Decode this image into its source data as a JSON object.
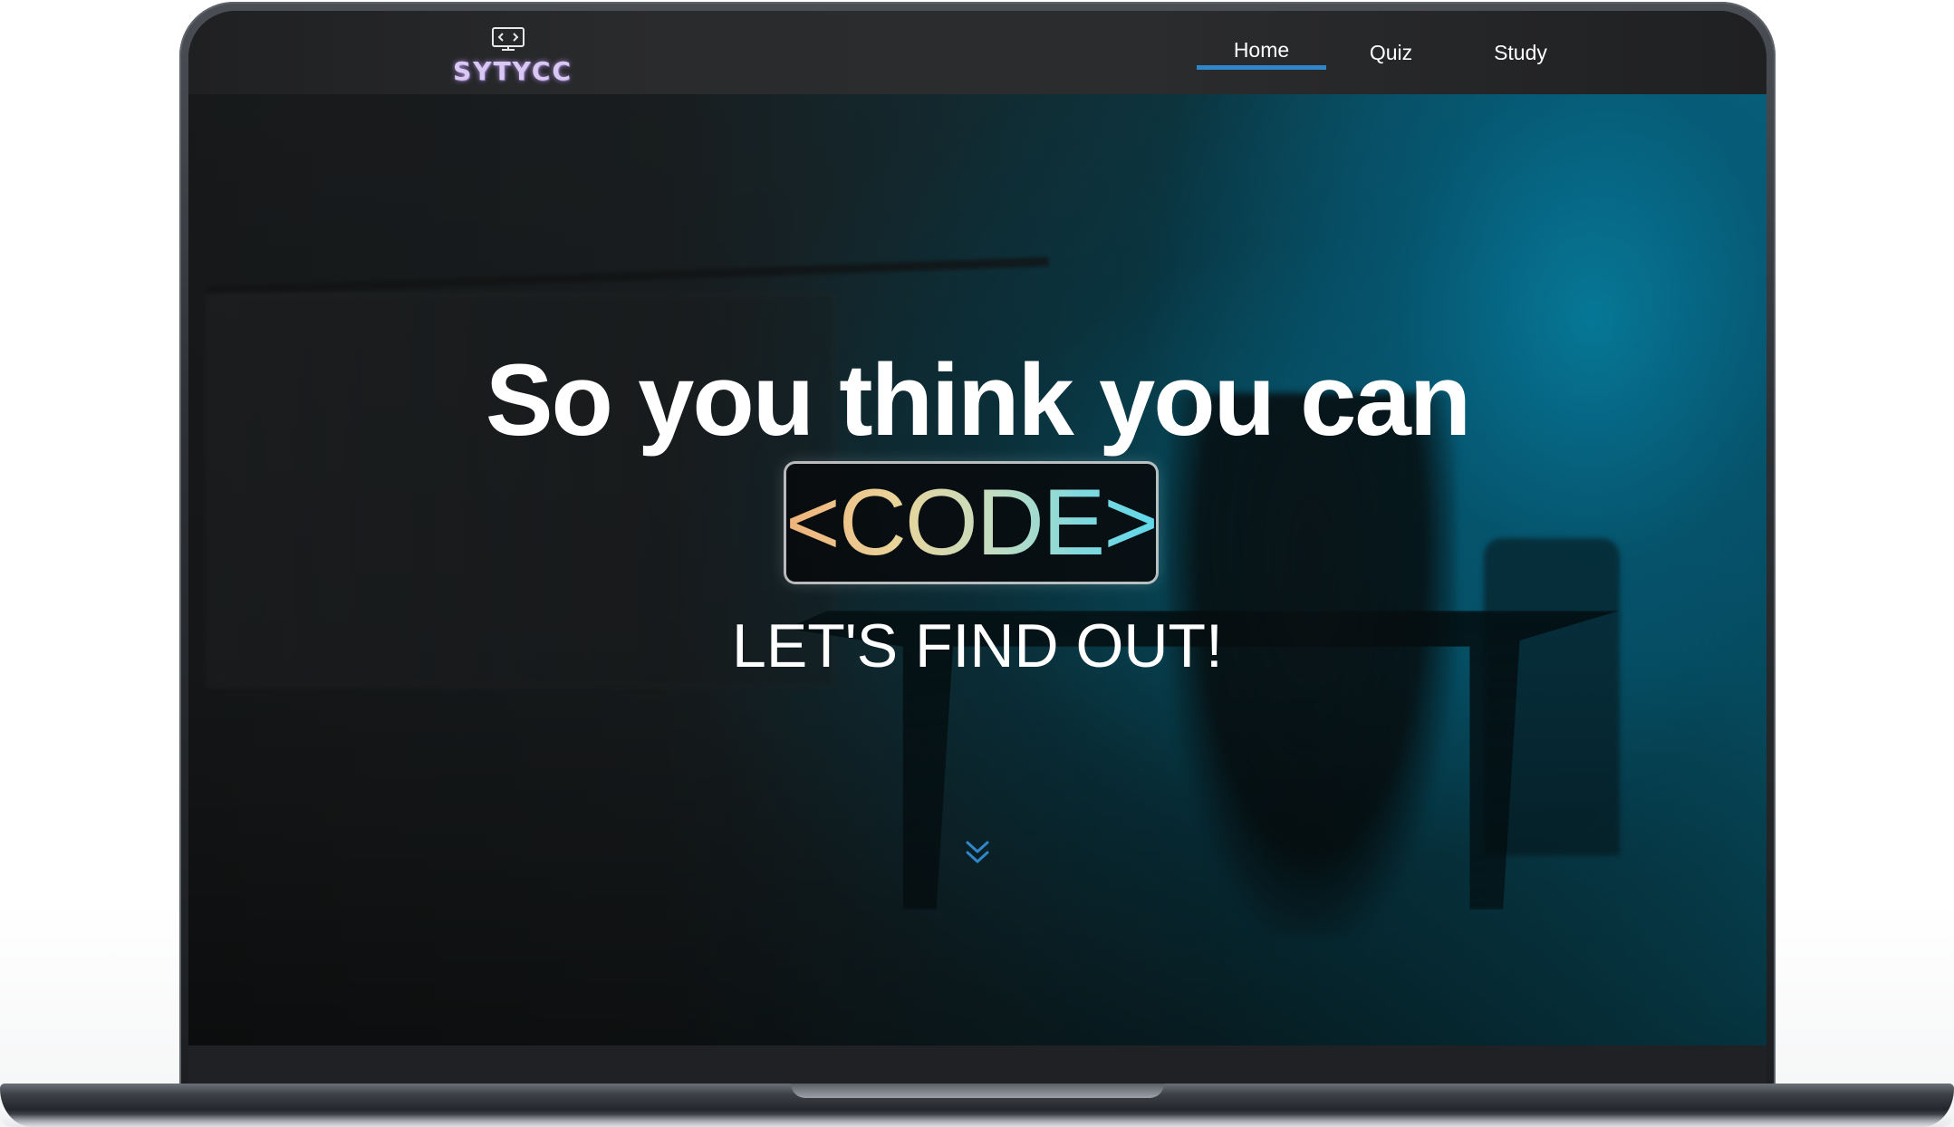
{
  "brand": {
    "logo_text": "SYTYCC",
    "logo_icon": "monitor-code-icon",
    "logo_color": "#d9c9f2"
  },
  "nav": {
    "items": [
      {
        "label": "Home",
        "active": true
      },
      {
        "label": "Quiz",
        "active": false
      },
      {
        "label": "Study",
        "active": false
      }
    ],
    "active_underline_color": "#2f86c8"
  },
  "hero": {
    "headline": "So you think you can",
    "code_word": "<CODE>",
    "subline": "LET'S FIND OUT!",
    "scroll_icon": "double-chevron-down-icon",
    "scroll_icon_color": "#2f86c8"
  },
  "colors": {
    "navbar_bg": "#2a2b2d",
    "hero_accent": "#0896be",
    "code_gradient": [
      "#f0b27a",
      "#e9d49a",
      "#c5dcc0",
      "#7fd9de",
      "#5fd8ea"
    ]
  }
}
